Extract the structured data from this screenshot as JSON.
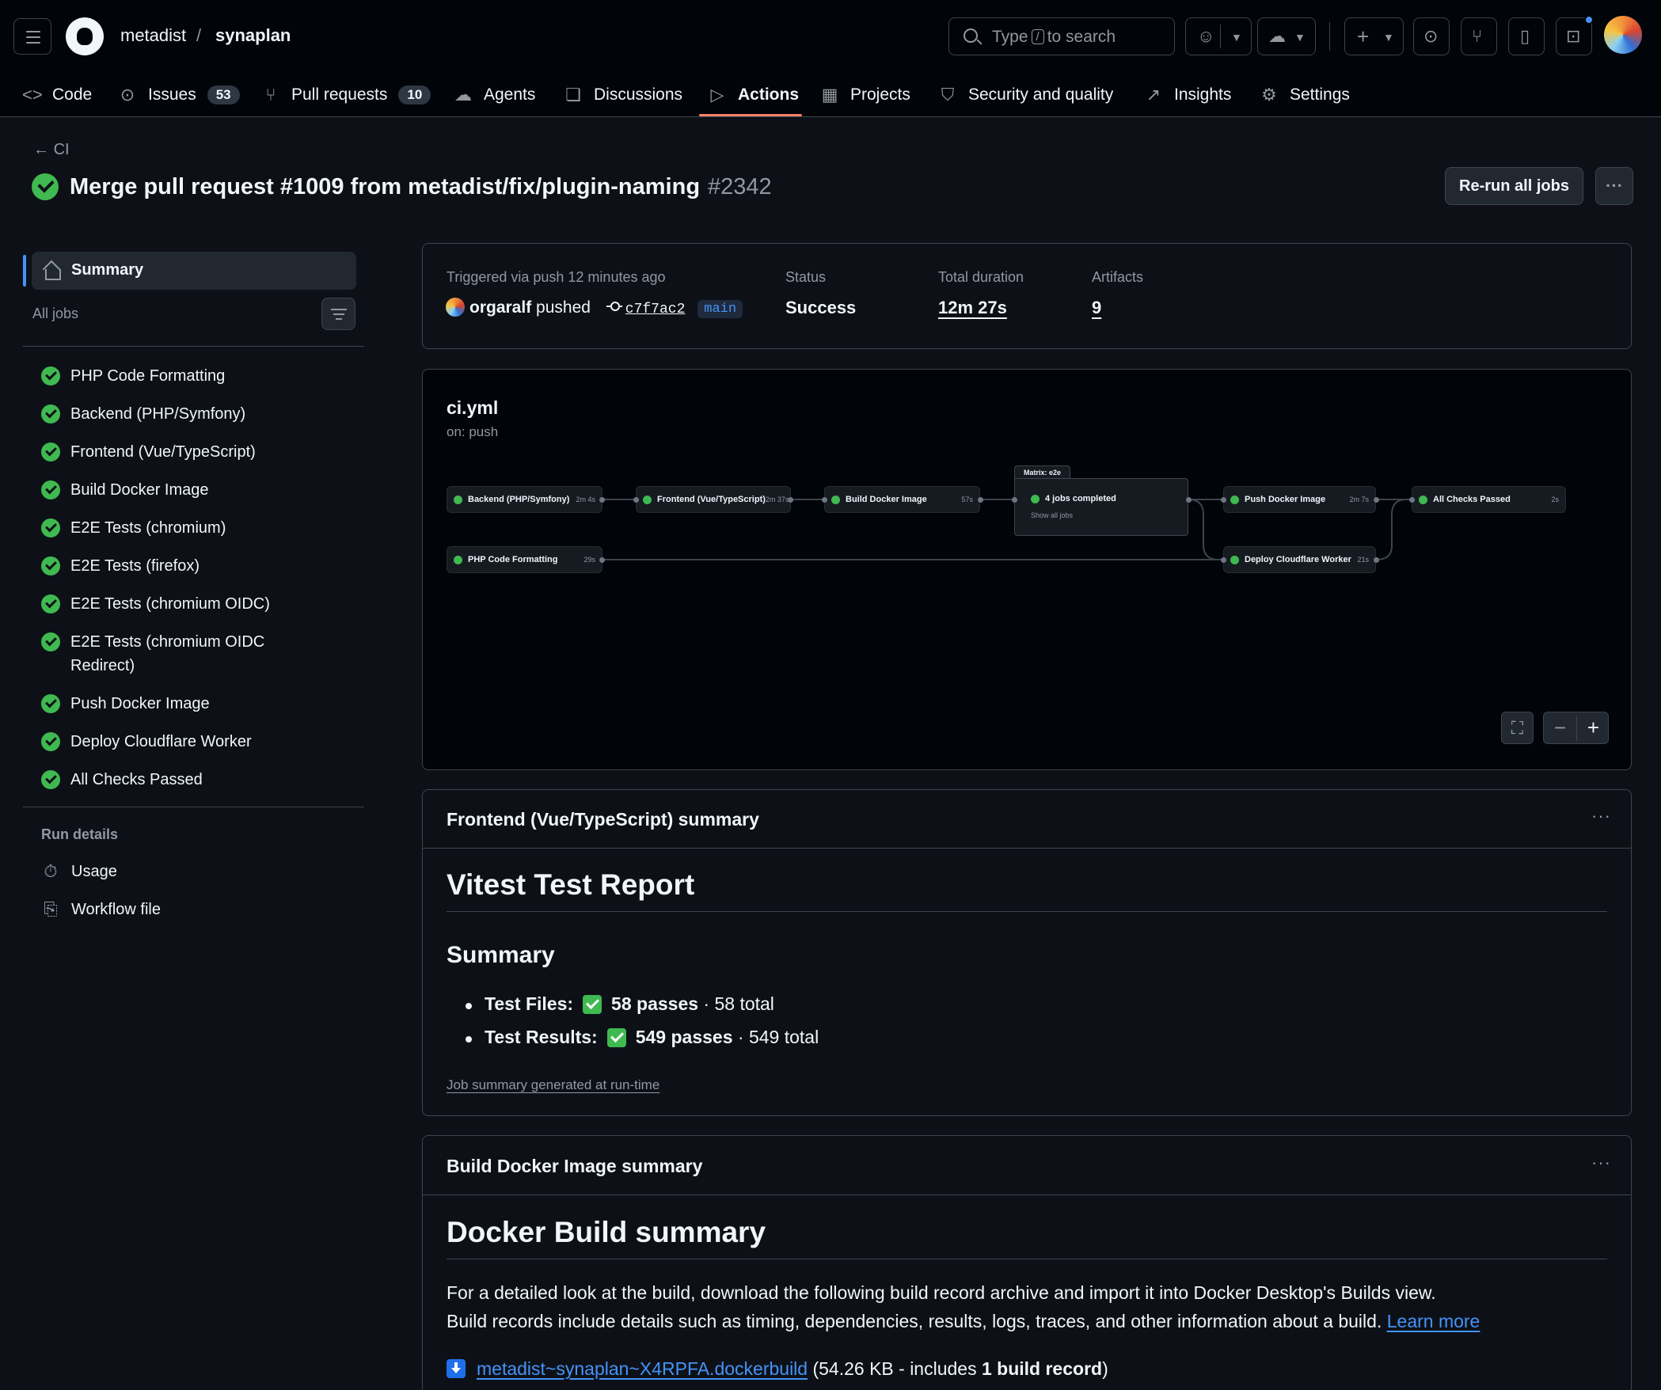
{
  "header": {
    "owner": "metadist",
    "separator": "/",
    "repo": "synaplan",
    "search": {
      "prefix": "Type",
      "key": "/",
      "suffix": "to search"
    }
  },
  "tabs": [
    {
      "label": "Code",
      "icon": "code-icon"
    },
    {
      "label": "Issues",
      "count": "53",
      "icon": "issue-icon"
    },
    {
      "label": "Pull requests",
      "count": "10",
      "icon": "pull-request-icon"
    },
    {
      "label": "Agents",
      "icon": "agents-icon"
    },
    {
      "label": "Discussions",
      "icon": "discussion-icon"
    },
    {
      "label": "Actions",
      "icon": "play-icon",
      "active": true
    },
    {
      "label": "Projects",
      "icon": "table-icon"
    },
    {
      "label": "Security and quality",
      "icon": "shield-icon"
    },
    {
      "label": "Insights",
      "icon": "graph-icon"
    },
    {
      "label": "Settings",
      "icon": "gear-icon"
    }
  ],
  "run": {
    "back_label": "CI",
    "title": "Merge pull request #1009 from metadist/fix/plugin-naming",
    "number": "#2342",
    "rerun_label": "Re-run all jobs"
  },
  "sidebar": {
    "summary_label": "Summary",
    "all_jobs_label": "All jobs",
    "jobs": [
      "PHP Code Formatting",
      "Backend (PHP/Symfony)",
      "Frontend (Vue/TypeScript)",
      "Build Docker Image",
      "E2E Tests (chromium)",
      "E2E Tests (firefox)",
      "E2E Tests (chromium OIDC)",
      "E2E Tests (chromium OIDC Redirect)",
      "Push Docker Image",
      "Deploy Cloudflare Worker",
      "All Checks Passed"
    ],
    "run_details_label": "Run details",
    "usage_label": "Usage",
    "workflow_file_label": "Workflow file"
  },
  "trigger": {
    "label": "Triggered via push 12 minutes ago",
    "actor": "orgaralf",
    "action": "pushed",
    "sha": "c7f7ac2",
    "branch": "main",
    "status_label": "Status",
    "status_value": "Success",
    "duration_label": "Total duration",
    "duration_value": "12m 27s",
    "artifacts_label": "Artifacts",
    "artifacts_value": "9"
  },
  "workflow": {
    "file": "ci.yml",
    "event": "on: push",
    "nodes": [
      {
        "name": "Backend (PHP/Symfony)",
        "duration": "2m 4s"
      },
      {
        "name": "Frontend (Vue/TypeScript)",
        "duration": "2m 37s"
      },
      {
        "name": "Build Docker Image",
        "duration": "57s"
      },
      {
        "name": "Push Docker Image",
        "duration": "2m 7s"
      },
      {
        "name": "All Checks Passed",
        "duration": "2s"
      },
      {
        "name": "PHP Code Formatting",
        "duration": "29s"
      },
      {
        "name": "Deploy Cloudflare Worker",
        "duration": "21s"
      }
    ],
    "matrix": {
      "label": "Matrix: e2e",
      "status": "4 jobs completed",
      "show_all": "Show all jobs"
    }
  },
  "frontend_summary": {
    "header": "Frontend (Vue/TypeScript) summary",
    "h1": "Vitest Test Report",
    "h2": "Summary",
    "files_label": "Test Files:",
    "files_passes": "58 passes",
    "files_total": "· 58 total",
    "results_label": "Test Results:",
    "results_passes": "549 passes",
    "results_total": "· 549 total",
    "note": "Job summary generated at run-time"
  },
  "docker_summary": {
    "header": "Build Docker Image summary",
    "h1": "Docker Build summary",
    "line1": "For a detailed look at the build, download the following build record archive and import it into Docker Desktop's Builds view.",
    "line2": "Build records include details such as timing, dependencies, results, logs, traces, and other information about a build.",
    "learn_more": "Learn more",
    "file_link": "metadist~synaplan~X4RPFA.dockerbuild",
    "size_prefix": "(54.26 KB - includes",
    "size_bold": "1 build record",
    "size_suffix": ")"
  }
}
